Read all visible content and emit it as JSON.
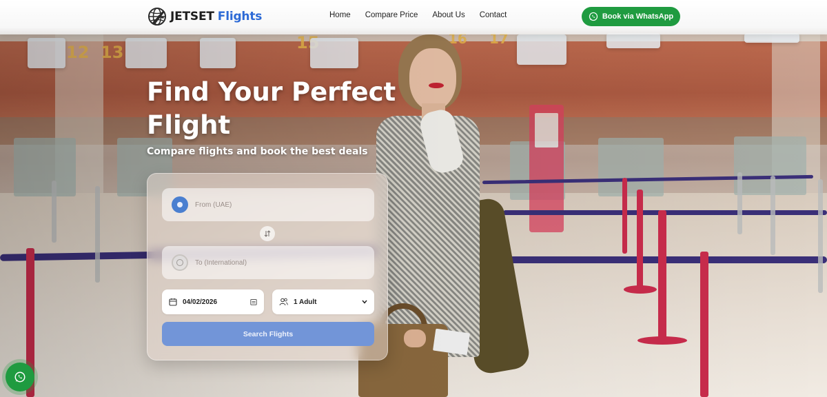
{
  "brand": {
    "name": "JETSET",
    "accent": "Flights",
    "logo_icon": "globe-plane-icon"
  },
  "nav": {
    "links": [
      {
        "label": "Home"
      },
      {
        "label": "Compare Price"
      },
      {
        "label": "About Us"
      },
      {
        "label": "Contact"
      }
    ],
    "cta_label": "Book via WhatsApp",
    "cta_icon": "whatsapp-icon"
  },
  "hero": {
    "headline_line1": "Find Your Perfect",
    "headline_line2": "Flight",
    "subheadline": "Compare flights and book the best deals"
  },
  "search": {
    "from_placeholder": "From (UAE)",
    "to_placeholder": "To (International)",
    "date_value": "04/02/2026",
    "passengers_value": "1 Adult",
    "button_label": "Search Flights"
  },
  "colors": {
    "brand_accent": "#2d6ad6",
    "whatsapp_green": "#1f9b40",
    "search_button": "#7295d8"
  },
  "background": {
    "gate_numbers": [
      "12",
      "13",
      "15",
      "16",
      "17"
    ]
  }
}
